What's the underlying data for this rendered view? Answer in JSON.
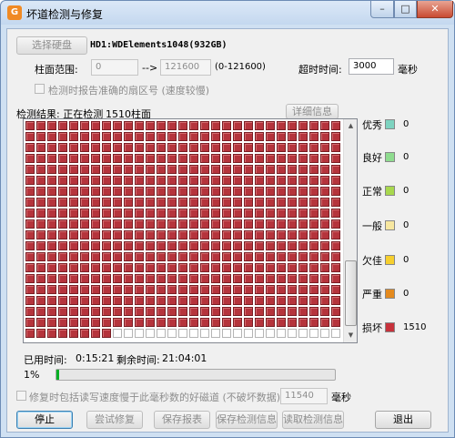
{
  "window": {
    "title": "坏道检测与修复",
    "app_icon": "G",
    "min": "–",
    "max": "□",
    "close": "✕"
  },
  "disk": {
    "select_button": "选择硬盘",
    "name": "HD1:WDElements1048(932GB)"
  },
  "range": {
    "label": "柱面范围:",
    "start": "0",
    "arrow": "-->",
    "end": "121600",
    "hint": "(0-121600)"
  },
  "timeout": {
    "label": "超时时间:",
    "value": "3000",
    "unit": "毫秒"
  },
  "options": {
    "report_sector": "检测时报告准确的扇区号 (速度较慢)",
    "repair_slow": "修复时包括读写速度慢于此毫秒数的好磁道 (不破坏数据):",
    "repair_ms": "11540",
    "repair_unit": "毫秒"
  },
  "status": {
    "result_label": "检测结果: 正在检测",
    "cylinder": "1510柱面",
    "details_button": "详细信息"
  },
  "legend": [
    {
      "label": "优秀",
      "color": "#7dd3c0",
      "count": "0"
    },
    {
      "label": "良好",
      "color": "#8fdc8f",
      "count": "0"
    },
    {
      "label": "正常",
      "color": "#a8d84e",
      "count": "0"
    },
    {
      "label": "一般",
      "color": "#f7e7a0",
      "count": "0"
    },
    {
      "label": "欠佳",
      "color": "#f6cf2e",
      "count": "0"
    },
    {
      "label": "严重",
      "color": "#e48a1e",
      "count": "0"
    },
    {
      "label": "损坏",
      "color": "#c7323b",
      "count": "1510"
    }
  ],
  "grid": {
    "bad_color": "#b5343c",
    "progress_fraction": 0.0124
  },
  "time": {
    "used_label": "已用时间:",
    "used": "0:15:21",
    "remaining_label": "剩余时间:",
    "remaining": "21:04:01",
    "percent": "1%",
    "progress": 0.01
  },
  "buttons": {
    "stop": "停止",
    "try_repair": "尝试修复",
    "save_report": "保存报表",
    "save_info": "保存检测信息",
    "read_info": "读取检测信息",
    "exit": "退出"
  }
}
